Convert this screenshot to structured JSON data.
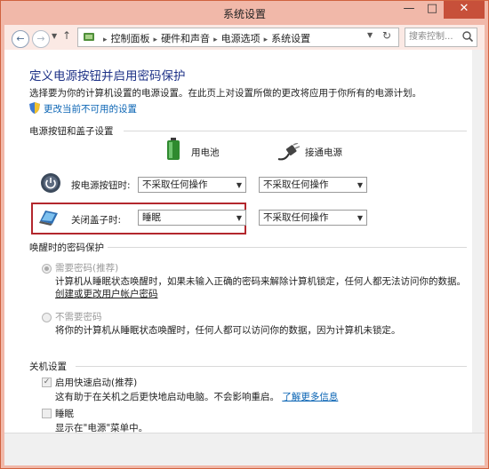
{
  "window": {
    "title": "系统设置",
    "min_glyph": "—",
    "max_glyph": "□",
    "close_glyph": "✕"
  },
  "address": {
    "crumbs": [
      "控制面板",
      "硬件和声音",
      "电源选项",
      "系统设置"
    ],
    "search_placeholder": "搜索控制..."
  },
  "page": {
    "heading": "定义电源按钮并启用密码保护",
    "description": "选择要为你的计算机设置的电源设置。在此页上对设置所做的更改将应用于你所有的电源计划。",
    "change_link": "更改当前不可用的设置"
  },
  "power_group": {
    "title": "电源按钮和盖子设置",
    "col_battery": "用电池",
    "col_plugged": "接通电源",
    "rows": [
      {
        "label": "按电源按钮时:",
        "battery_value": "不采取任何操作",
        "plugged_value": "不采取任何操作"
      },
      {
        "label": "关闭盖子时:",
        "battery_value": "睡眠",
        "plugged_value": "不采取任何操作"
      }
    ],
    "highlight_color": "#b3272d"
  },
  "wake_group": {
    "title": "唤醒时的密码保护",
    "option1": {
      "label": "需要密码(推荐)",
      "line1": "计算机从睡眠状态唤醒时，如果未输入正确的密码来解除计算机锁定，任何人都无法访问你的数据。",
      "link": "创建或更改用户帐户密码"
    },
    "option2": {
      "label": "不需要密码",
      "line1": "将你的计算机从睡眠状态唤醒时，任何人都可以访问你的数据，因为计算机未锁定。"
    }
  },
  "shutdown_group": {
    "title": "关机设置",
    "fast_startup": {
      "label": "启用快速启动(推荐)",
      "desc": "这有助于在关机之后更快地启动电脑。不会影响重启。",
      "link": "了解更多信息",
      "checked": true
    },
    "sleep": {
      "label": "睡眠",
      "desc": "显示在\"电源\"菜单中。",
      "checked": false
    }
  },
  "colors": {
    "accent_frame": "#d0623f",
    "heading": "#1e3287",
    "link": "#0a64b4"
  }
}
